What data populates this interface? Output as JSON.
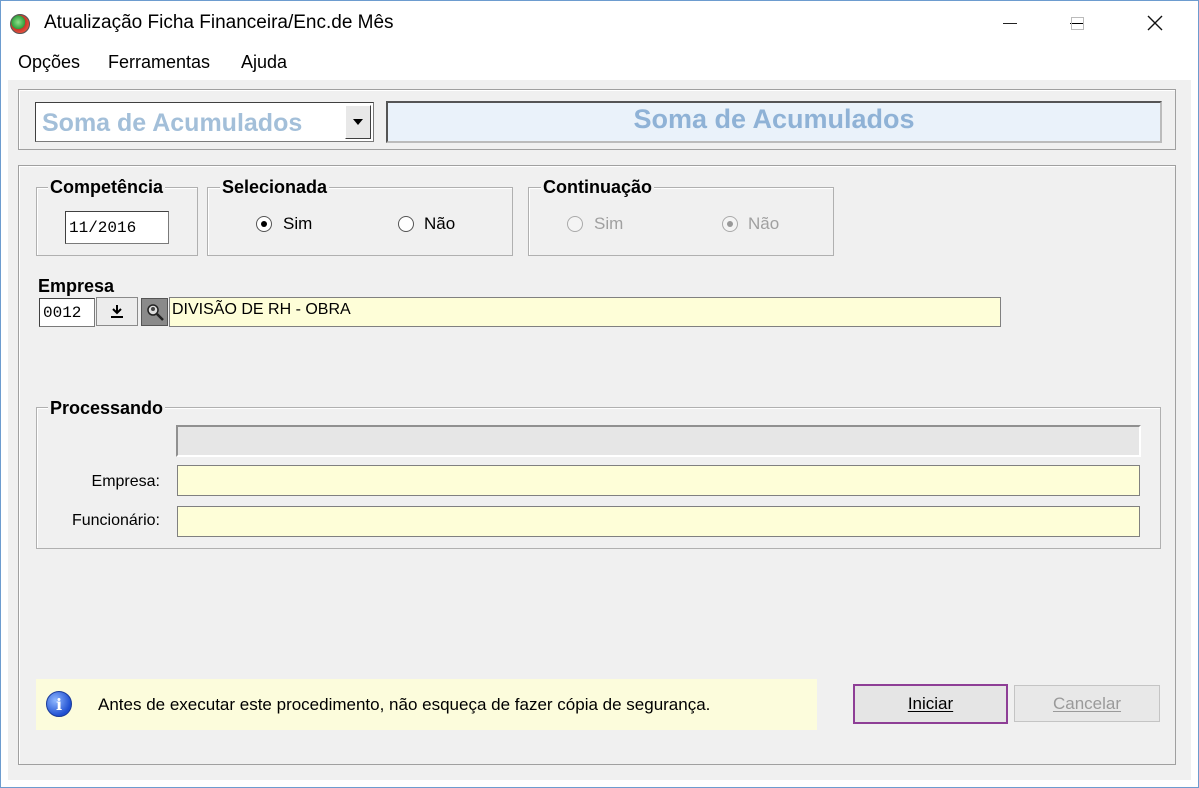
{
  "window": {
    "title": "Atualização Ficha Financeira/Enc.de Mês",
    "controls": {
      "minimize": "minimize-icon",
      "maximize": "maximize-icon",
      "close": "close-icon"
    }
  },
  "menu": [
    "Opções",
    "Ferramentas",
    "Ajuda"
  ],
  "header": {
    "selector_value": "Soma de Acumulados",
    "banner_text": "Soma de Acumulados"
  },
  "competencia": {
    "legend": "Competência",
    "value": "11/2016"
  },
  "selecionada": {
    "legend": "Selecionada",
    "options": [
      {
        "label": "Sim",
        "checked": true
      },
      {
        "label": "Não",
        "checked": false
      }
    ]
  },
  "continuacao": {
    "legend": "Continuação",
    "disabled": true,
    "options": [
      {
        "label": "Sim",
        "checked": false
      },
      {
        "label": "Não",
        "checked": true
      }
    ]
  },
  "empresa": {
    "label": "Empresa",
    "code": "0012",
    "name": "DIVISÃO DE RH - OBRA"
  },
  "processando": {
    "legend": "Processando",
    "progress": 0,
    "empresa_label": "Empresa:",
    "empresa_value": "",
    "funcionario_label": "Funcionário:",
    "funcionario_value": ""
  },
  "info": {
    "icon": "info-icon",
    "text": "Antes de executar este procedimento, não esqueça de fazer cópia de segurança."
  },
  "buttons": {
    "start": "Iniciar",
    "cancel": "Cancelar"
  },
  "colors": {
    "banner_text": "#8fb2d6",
    "yellow_field": "#fefed8",
    "info_bg": "#fcfcdc",
    "focus_border": "#8e3e96"
  }
}
